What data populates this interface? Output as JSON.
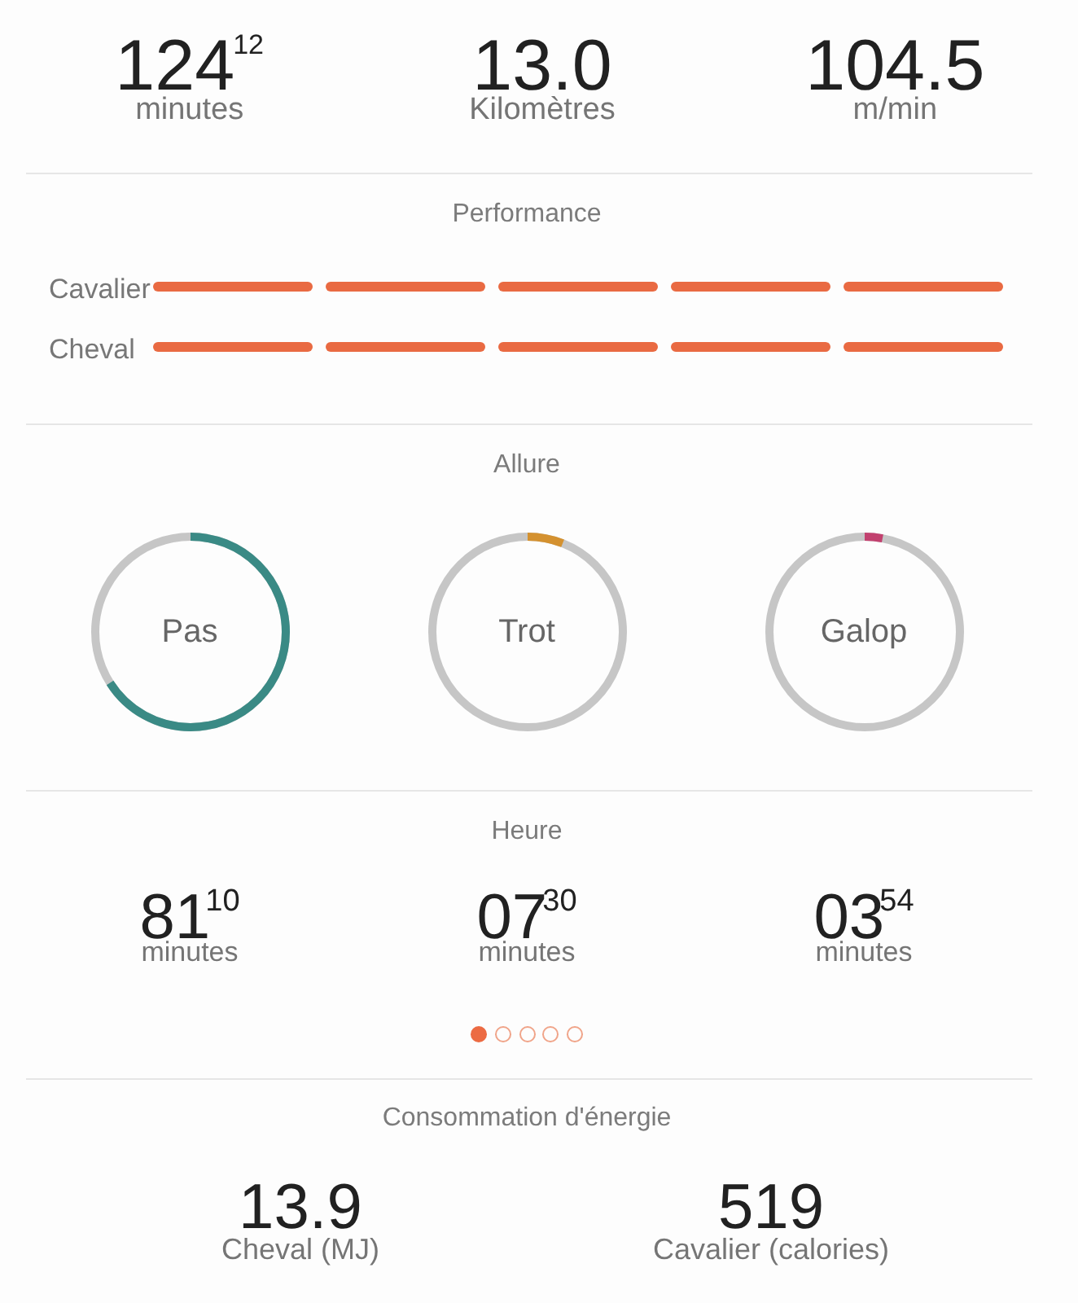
{
  "summary": [
    {
      "value": "124$^{12}$",
      "unit": "minutes"
    },
    {
      "value": "13.0",
      "unit": "Kilomètres"
    },
    {
      "value": "104.5",
      "unit": "m/min"
    }
  ],
  "performance": {
    "title": "Performance",
    "rows": [
      {
        "label": "Cavalier",
        "stars": 5
      },
      {
        "label": "Cheval",
        "stars": 5
      }
    ]
  },
  "gait": {
    "title": "Allure",
    "items": [
      {
        "label": "Pas",
        "level": 0.66,
        "color": "#3a8a85"
      },
      {
        "label": "Trot",
        "level": 0.06,
        "color": "#d4912f"
      },
      {
        "label": "Galop",
        "level": 0.03,
        "color": "#c2416f"
      }
    ]
  },
  "time": {
    "title": "Heure",
    "items": [
      {
        "value": "81$^{10}$",
        "unit": "minutes"
      },
      {
        "value": "07$^{30}$",
        "unit": "minutes"
      },
      {
        "value": "03$^{54}$",
        "unit": "minutes"
      }
    ],
    "pager": [
      {
        "selected": true
      },
      {
        "selected": false
      },
      {
        "selected": false
      },
      {
        "selected": false
      },
      {
        "selected": false
      }
    ]
  },
  "energy": {
    "title": "Consommation d'énergie",
    "items": [
      {
        "value": "13.9",
        "unit": "Cheval (MJ)"
      },
      {
        "value": "519",
        "unit": "Cavalier (calories)"
      }
    ]
  }
}
